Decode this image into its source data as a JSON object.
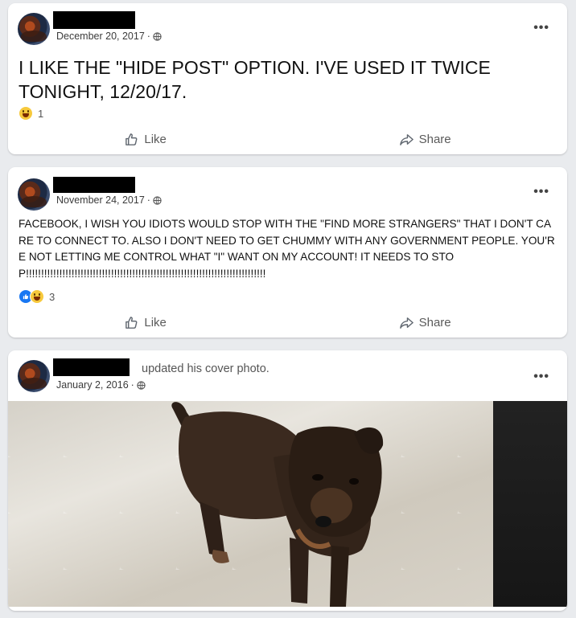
{
  "posts": [
    {
      "date": "December 20, 2017",
      "text": "I LIKE THE \"HIDE POST\" OPTION. I'VE USED IT TWICE TONIGHT, 12/20/17.",
      "reaction_count": "1",
      "like_label": "Like",
      "share_label": "Share"
    },
    {
      "date": "November 24, 2017",
      "text": "FACEBOOK, I WISH YOU IDIOTS WOULD STOP WITH THE \"FIND MORE STRANGERS\" THAT I DON'T CARE TO CONNECT TO. ALSO I DON'T NEED TO GET CHUMMY WITH ANY GOVERNMENT PEOPLE. YOU'RE NOT LETTING ME CONTROL WHAT \"I\" WANT ON MY ACCOUNT! IT NEEDS TO STOP!!!!!!!!!!!!!!!!!!!!!!!!!!!!!!!!!!!!!!!!!!!!!!!!!!!!!!!!!!!!!!!!!!!!!!!!!!!!!!!",
      "reaction_count": "3",
      "like_label": "Like",
      "share_label": "Share"
    },
    {
      "date": "January 2, 2016",
      "activity": "updated his cover photo."
    }
  ],
  "more_glyph": "•••",
  "separator": "·",
  "colors": {
    "page_bg": "#e9ebee",
    "card_bg": "#ffffff",
    "like_blue": "#1877f2",
    "redaction": "#000000"
  },
  "icons": [
    "globe-icon",
    "more-options-icon",
    "like-icon",
    "share-icon",
    "haha-reaction-icon",
    "like-reaction-icon"
  ]
}
